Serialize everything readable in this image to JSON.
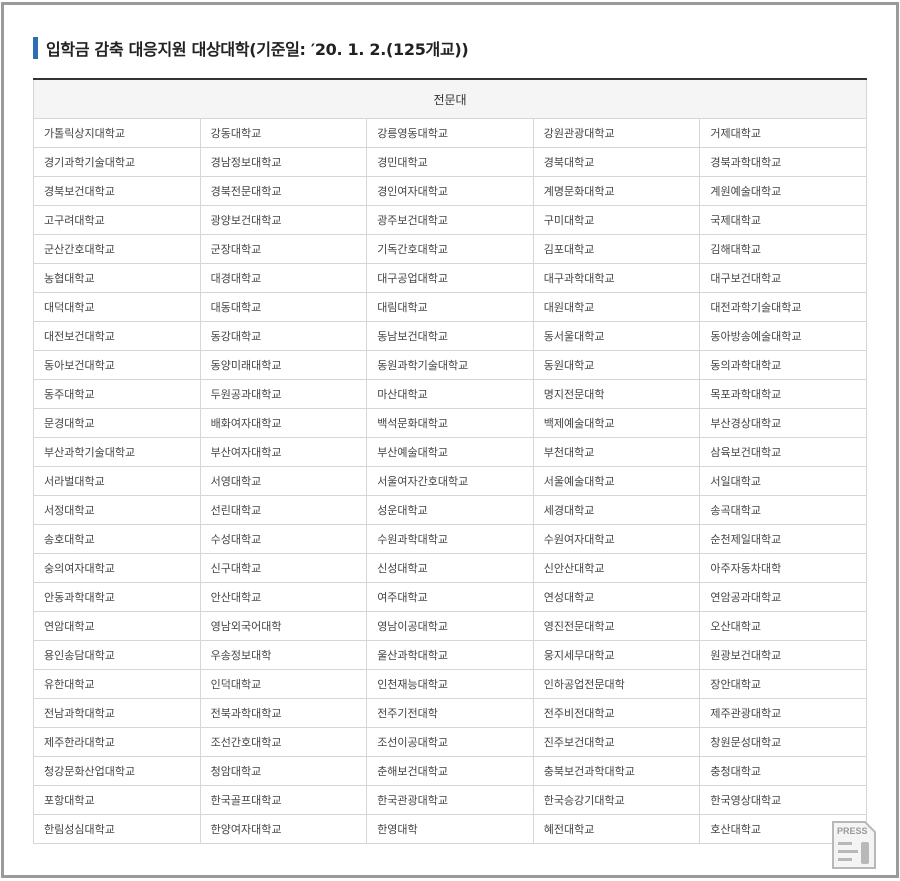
{
  "heading": {
    "title": "입학금 감축 대응지원 대상대학(기준일: ′20. 1. 2.(125개교))"
  },
  "table": {
    "header": "전문대",
    "rows": [
      [
        "가톨릭상지대학교",
        "강동대학교",
        "강릉영동대학교",
        "강원관광대학교",
        "거제대학교"
      ],
      [
        "경기과학기술대학교",
        "경남정보대학교",
        "경민대학교",
        "경북대학교",
        "경북과학대학교"
      ],
      [
        "경북보건대학교",
        "경북전문대학교",
        "경인여자대학교",
        "계명문화대학교",
        "계원예술대학교"
      ],
      [
        "고구려대학교",
        "광양보건대학교",
        "광주보건대학교",
        "구미대학교",
        "국제대학교"
      ],
      [
        "군산간호대학교",
        "군장대학교",
        "기독간호대학교",
        "김포대학교",
        "김해대학교"
      ],
      [
        "농협대학교",
        "대경대학교",
        "대구공업대학교",
        "대구과학대학교",
        "대구보건대학교"
      ],
      [
        "대덕대학교",
        "대동대학교",
        "대림대학교",
        "대원대학교",
        "대전과학기술대학교"
      ],
      [
        "대전보건대학교",
        "동강대학교",
        "동남보건대학교",
        "동서울대학교",
        "동아방송예술대학교"
      ],
      [
        "동아보건대학교",
        "동양미래대학교",
        "동원과학기술대학교",
        "동원대학교",
        "동의과학대학교"
      ],
      [
        "동주대학교",
        "두원공과대학교",
        "마산대학교",
        "명지전문대학",
        "목포과학대학교"
      ],
      [
        "문경대학교",
        "배화여자대학교",
        "백석문화대학교",
        "백제예술대학교",
        "부산경상대학교"
      ],
      [
        "부산과학기술대학교",
        "부산여자대학교",
        "부산예술대학교",
        "부천대학교",
        "삼육보건대학교"
      ],
      [
        "서라벌대학교",
        "서영대학교",
        "서울여자간호대학교",
        "서울예술대학교",
        "서일대학교"
      ],
      [
        "서정대학교",
        "선린대학교",
        "성운대학교",
        "세경대학교",
        "송곡대학교"
      ],
      [
        "송호대학교",
        "수성대학교",
        "수원과학대학교",
        "수원여자대학교",
        "순천제일대학교"
      ],
      [
        "숭의여자대학교",
        "신구대학교",
        "신성대학교",
        "신안산대학교",
        "아주자동차대학"
      ],
      [
        "안동과학대학교",
        "안산대학교",
        "여주대학교",
        "연성대학교",
        "연암공과대학교"
      ],
      [
        "연암대학교",
        "영남외국어대학",
        "영남이공대학교",
        "영진전문대학교",
        "오산대학교"
      ],
      [
        "용인송담대학교",
        "우송정보대학",
        "울산과학대학교",
        "웅지세무대학교",
        "원광보건대학교"
      ],
      [
        "유한대학교",
        "인덕대학교",
        "인천재능대학교",
        "인하공업전문대학",
        "장안대학교"
      ],
      [
        "전남과학대학교",
        "전북과학대학교",
        "전주기전대학",
        "전주비전대학교",
        "제주관광대학교"
      ],
      [
        "제주한라대학교",
        "조선간호대학교",
        "조선이공대학교",
        "진주보건대학교",
        "창원문성대학교"
      ],
      [
        "청강문화산업대학교",
        "청암대학교",
        "춘해보건대학교",
        "충북보건과학대학교",
        "충청대학교"
      ],
      [
        "포항대학교",
        "한국골프대학교",
        "한국관광대학교",
        "한국승강기대학교",
        "한국영상대학교"
      ],
      [
        "한림성심대학교",
        "한양여자대학교",
        "한영대학",
        "혜전대학교",
        "호산대학교"
      ]
    ]
  },
  "watermark": {
    "label": "PRESS",
    "icon": "press-document-icon"
  },
  "colors": {
    "accent_bar": "#2e6db4",
    "frame_border": "#9a9a9a",
    "header_bg": "#f5f5f5",
    "cell_border": "#d6d6d6"
  }
}
